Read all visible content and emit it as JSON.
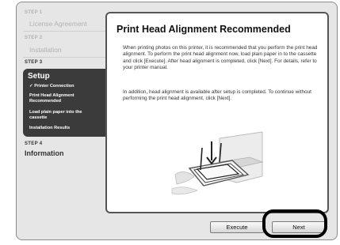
{
  "sidebar": {
    "steps": [
      {
        "step": "STEP 1",
        "name": "License Agreement"
      },
      {
        "step": "STEP 2",
        "name": "Installation"
      },
      {
        "step": "STEP 3",
        "name": "Setup",
        "substeps": [
          "✓ Printer Connection",
          "Print Head Alignment Recommended",
          "Load plain paper into the cassette",
          "Installation Results"
        ]
      },
      {
        "step": "STEP 4",
        "name": "Information"
      }
    ]
  },
  "content": {
    "title": "Print Head Alignment Recommended",
    "paragraph1": "When printing photos on this printer, it is recommended that you perform the print head alignment. To perform the print head alignment now, load plain paper in to the cassette and click [Execute]. After head alignment is completed, click [Next]. For details, refer to your printer manual.",
    "paragraph2": "In addition, head alignment is available after setup is completed. To continue without performing the print head alignment, click [Next]."
  },
  "buttons": {
    "execute_label": "Execute",
    "next_label": "Next"
  }
}
